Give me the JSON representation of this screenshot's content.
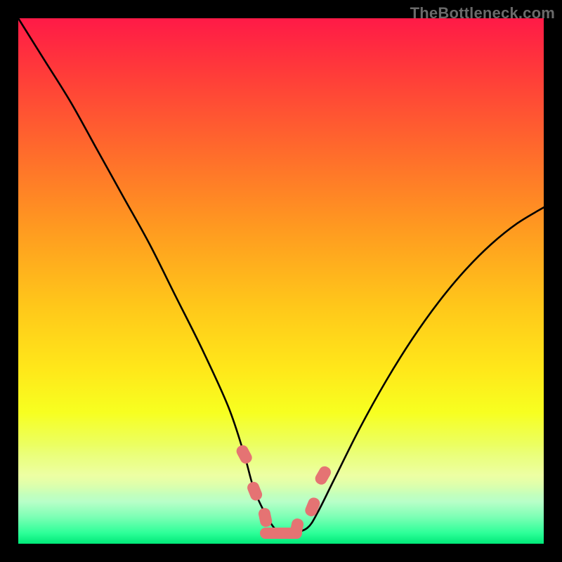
{
  "watermark": "TheBottleneck.com",
  "colors": {
    "background": "#000000",
    "curve_stroke": "#000000",
    "marker_fill": "#e57373",
    "gradient_top": "#ff1a47",
    "gradient_bottom": "#00e878"
  },
  "chart_data": {
    "type": "line",
    "title": "",
    "xlabel": "",
    "ylabel": "",
    "xlim": [
      0,
      100
    ],
    "ylim": [
      0,
      100
    ],
    "legend": false,
    "grid": false,
    "series": [
      {
        "name": "bottleneck-curve",
        "x": [
          0,
          5,
          10,
          15,
          20,
          25,
          30,
          35,
          40,
          43,
          45,
          48,
          50,
          52,
          55,
          57,
          60,
          65,
          70,
          75,
          80,
          85,
          90,
          95,
          100
        ],
        "y": [
          100,
          92,
          84,
          75,
          66,
          57,
          47,
          37,
          26,
          17,
          10,
          4,
          2,
          2,
          3,
          6,
          12,
          22,
          31,
          39,
          46,
          52,
          57,
          61,
          64
        ]
      }
    ],
    "markers": [
      {
        "x": 43,
        "y": 17
      },
      {
        "x": 45,
        "y": 10
      },
      {
        "x": 47,
        "y": 5
      },
      {
        "x": 50,
        "y": 2
      },
      {
        "x": 53,
        "y": 3
      },
      {
        "x": 56,
        "y": 7
      },
      {
        "x": 58,
        "y": 13
      }
    ],
    "annotations": []
  }
}
